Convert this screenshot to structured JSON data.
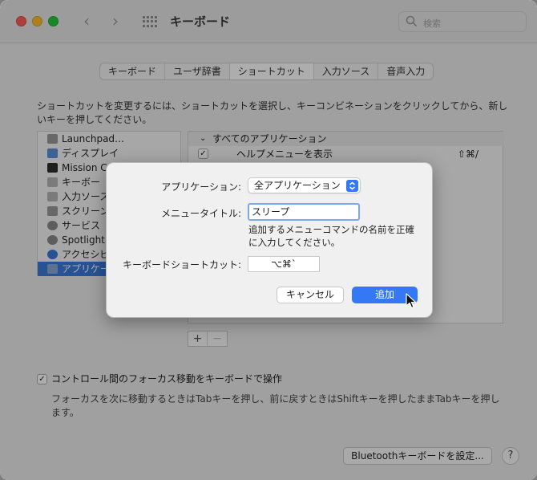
{
  "window": {
    "title": "キーボード",
    "search_placeholder": "検索"
  },
  "tabs": [
    "キーボード",
    "ユーザ辞書",
    "ショートカット",
    "入力ソース",
    "音声入力"
  ],
  "description": "ショートカットを変更するには、ショートカットを選択し、キーコンビネーションをクリックしてから、新しいキーを押してください。",
  "left_list": [
    {
      "label": "Launchpad…",
      "icon": "launchpad-icon",
      "color": "#9a9a9a"
    },
    {
      "label": "ディスプレイ",
      "icon": "display-icon",
      "color": "#5b8fd8"
    },
    {
      "label": "Mission C",
      "icon": "mission-control-icon",
      "color": "#2f2f2f"
    },
    {
      "label": "キーボー",
      "icon": "keyboard-icon",
      "color": "#b5b5b5"
    },
    {
      "label": "入力ソース",
      "icon": "input-source-icon",
      "color": "#b5b5b5"
    },
    {
      "label": "スクリーン",
      "icon": "screenshot-icon",
      "color": "#9a9a9a"
    },
    {
      "label": "サービス",
      "icon": "gear-icon",
      "color": "#8a8a8a"
    },
    {
      "label": "Spotlight",
      "icon": "search-icon",
      "color": "#8a8a8a"
    },
    {
      "label": "アクセシビ",
      "icon": "accessibility-icon",
      "color": "#3a7bdc"
    },
    {
      "label": "アプリケー",
      "icon": "app-shortcuts-icon",
      "color": "#8aa9d8"
    }
  ],
  "right_list": {
    "group": "すべてのアプリケーション",
    "row_label": "ヘルプメニューを表示",
    "row_shortcut": "⇧⌘/"
  },
  "control_row": {
    "label": "コントロール間のフォーカス移動をキーボードで操作",
    "description": "フォーカスを次に移動するときはTabキーを押し、前に戻すときはShiftキーを押したままTabキーを押します。"
  },
  "bluetooth_button": "Bluetoothキーボードを設定...",
  "help_button": "?",
  "dialog": {
    "app_label": "アプリケーション:",
    "app_value": "全アプリケーション",
    "menu_title_label": "メニュータイトル:",
    "menu_title_value": "スリープ",
    "hint": "追加するメニューコマンドの名前を正確に入力してください。",
    "shortcut_label": "キーボードショートカット:",
    "shortcut_value": "⌥⌘`",
    "cancel": "キャンセル",
    "add": "追加"
  },
  "plus_minus": [
    "+",
    "−"
  ],
  "check_mark": "✓",
  "chevron": "⌄"
}
